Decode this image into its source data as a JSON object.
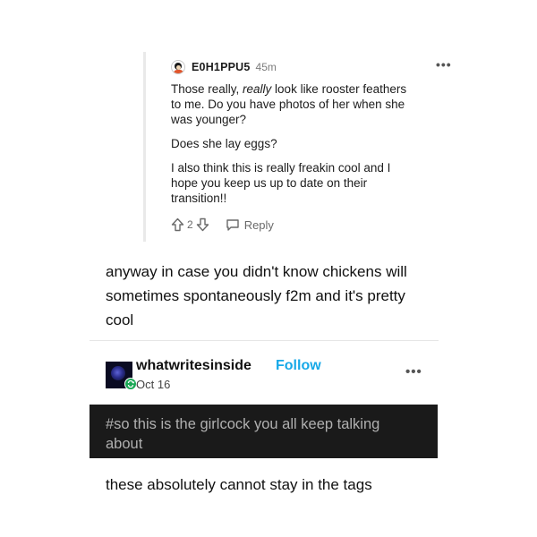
{
  "comment": {
    "username": "E0H1PPU5",
    "time": "45m",
    "more": "•••",
    "line1_prefix": "Those really, ",
    "line1_emph": "really",
    "line1_suffix": " look like rooster feathers",
    "line2": "to me. Do you have photos of her when she",
    "line3": "was younger?",
    "line4": "Does she lay eggs?",
    "line5": "I also think this is really freakin cool and I",
    "line6": "hope you keep us up to date on their",
    "line7": "transition!!",
    "vote_count": "2",
    "reply_label": "Reply"
  },
  "post": {
    "line1": "anyway in case you didn't know chickens will",
    "line2": "sometimes spontaneously f2m and it's pretty",
    "line3": "cool"
  },
  "reblog": {
    "blog_name": "whatwritesinside",
    "follow_label": "Follow",
    "date": "Oct 16",
    "more": "•••",
    "tag_line1": "#so this is the girlcock you all keep talking",
    "tag_line2": "about",
    "body": "these absolutely cannot stay in the tags"
  },
  "colors": {
    "follow": "#17a9e8",
    "tag_background": "#1a1a1a",
    "tag_text": "#b0b0b0",
    "reblog_badge": "#1aa855"
  }
}
